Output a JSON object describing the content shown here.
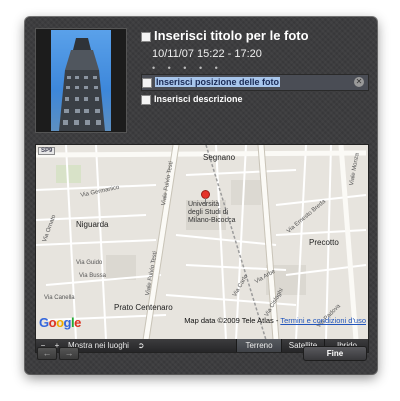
{
  "photo_info": {
    "title_placeholder": "Inserisci titolo per le foto",
    "date_range": "10/11/07 15:22 - 17:20",
    "rating": "• • • • •",
    "location_placeholder": "Inserisci posizione delle foto",
    "description_placeholder": "Inserisci descrizione"
  },
  "map": {
    "road_badge": "SP9",
    "places": {
      "segnano": "Segnano",
      "niguarda": "Niguarda",
      "precotto": "Precotto",
      "prato_centenaro": "Prato Centenaro",
      "university": [
        "Università",
        "degli Studi di",
        "Milano-Bicocca"
      ]
    },
    "streets": {
      "via_fulvio_testi_1": "Viale Fulvio Testi",
      "via_fulvio_testi_2": "Viale Fulvio Testi",
      "viale_monza": "Viale Monza",
      "via_ornato": "Via Ornato",
      "via_germanico": "Via Germanico",
      "via_guido": "Via Guido",
      "via_bussa": "Via Bussa",
      "via_canella": "Via Canella",
      "via_ernesto_breda": "Via Ernesto Breda",
      "via_padova": "Via Padova",
      "via_cislaghi": "Via Cislaghi",
      "via_carlo": "Via Carlo",
      "via_arbe": "Via Arbe"
    },
    "logo": "Google",
    "copyright": "Map data ©2009 Tele Atlas - ",
    "terms": "Termini e condizioni d'uso"
  },
  "toolbar": {
    "zoom_out": "−",
    "zoom_in": "+",
    "show_in_places": "Mostra nei luoghi",
    "types": [
      "Terreno",
      "Satellite",
      "Ibrido"
    ],
    "active_type": "Terreno"
  },
  "footer": {
    "prev": "←",
    "next": "→",
    "done": "Fine"
  }
}
